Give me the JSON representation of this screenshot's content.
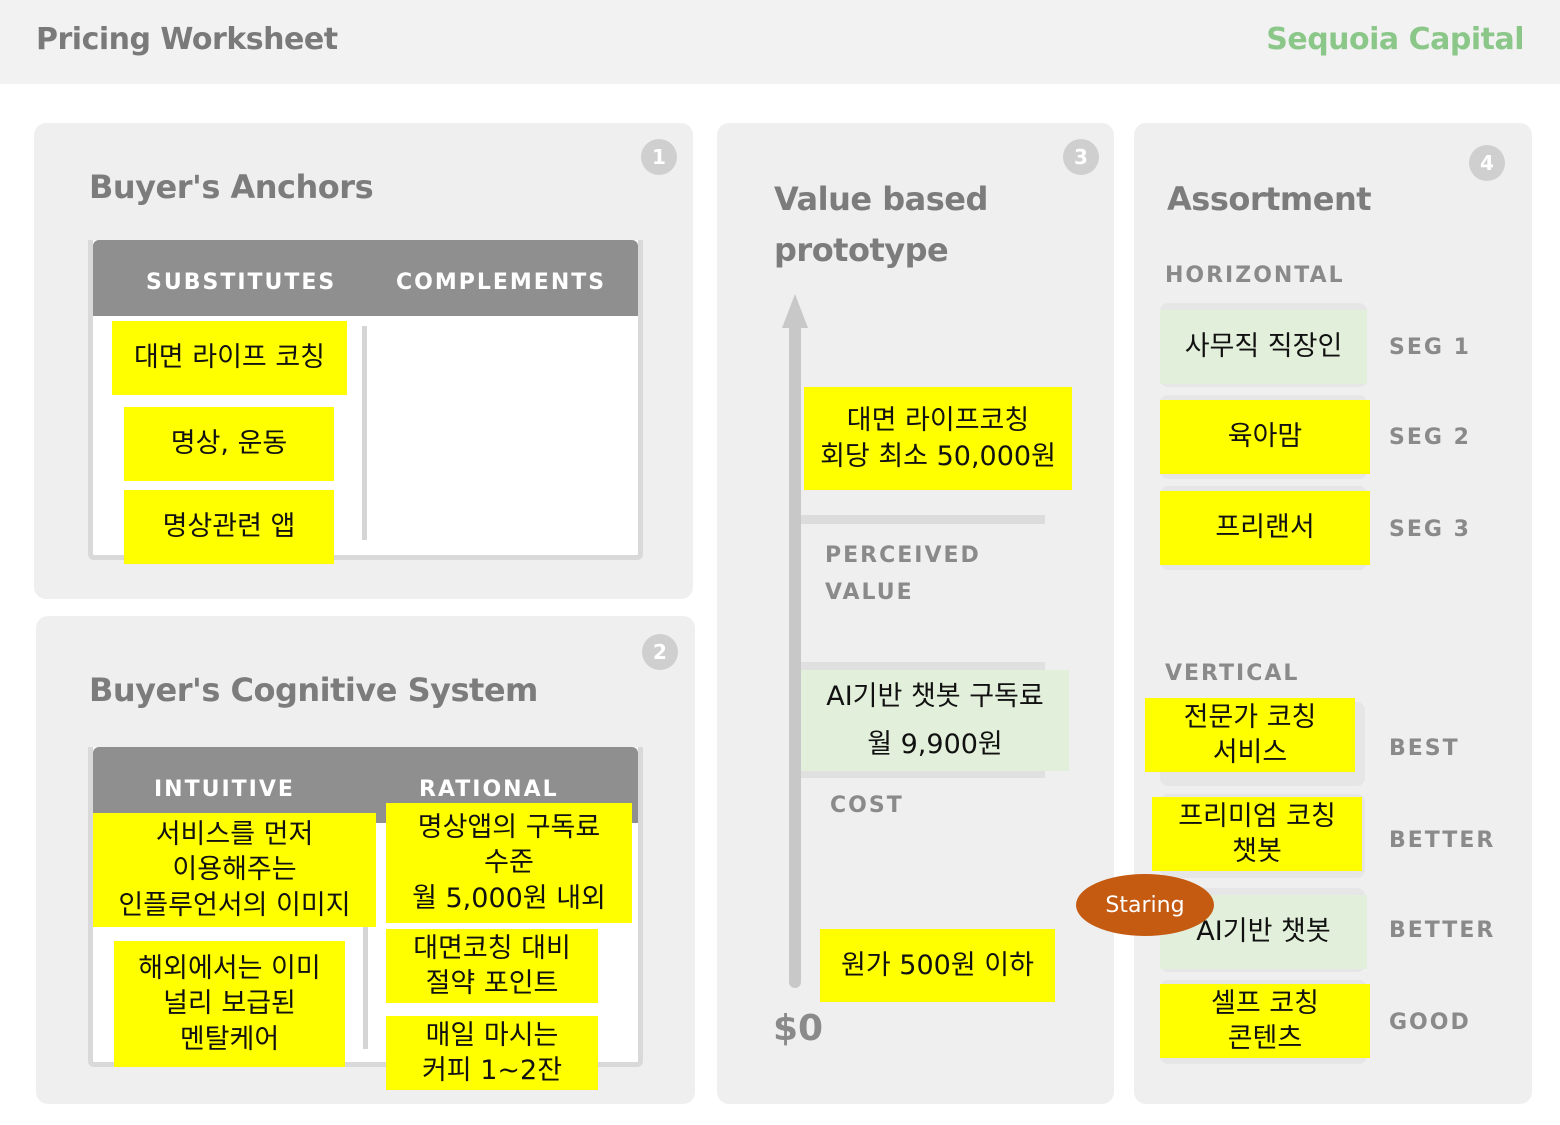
{
  "header": {
    "title": "Pricing Worksheet",
    "brand": "Sequoia Capital"
  },
  "anchors": {
    "num": "1",
    "title": "Buyer's Anchors",
    "col1": "SUBSTITUTES",
    "col2": "COMPLEMENTS",
    "notes": [
      "대면 라이프 코칭",
      "명상, 운동",
      "명상관련 앱"
    ]
  },
  "cognitive": {
    "num": "2",
    "title": "Buyer's Cognitive System",
    "col1": "INTUITIVE",
    "col2": "RATIONAL",
    "intuitive_notes": [
      "서비스를 먼저\n이용해주는\n인플루언서의 이미지",
      "해외에서는 이미\n널리 보급된\n멘탈케어"
    ],
    "rational_notes": [
      "명상앱의 구독료\n수준\n월 5,000원 내외",
      "대면코칭 대비\n절약 포인트",
      "매일 마시는\n커피 1~2잔"
    ]
  },
  "value": {
    "num": "3",
    "title": "Value based\nprototype",
    "perceived_label": "PERCEIVED\nVALUE",
    "cost_label": "COST",
    "zero_label": "$0",
    "perceived_note": "대면 라이프코칭\n회당 최소 50,000원",
    "price_note": "AI기반 챗봇 구독료\n월 9,900원",
    "cost_note": "원가 500원 이하"
  },
  "assortment": {
    "num": "4",
    "title": "Assortment",
    "horizontal_label": "HORIZONTAL",
    "vertical_label": "VERTICAL",
    "horizontal": [
      {
        "text": "사무직 직장인",
        "seg": "SEG 1"
      },
      {
        "text": "육아맘",
        "seg": "SEG 2"
      },
      {
        "text": "프리랜서",
        "seg": "SEG 3"
      }
    ],
    "vertical": [
      {
        "text": "전문가 코칭\n서비스",
        "tier": "BEST"
      },
      {
        "text": "프리미엄 코칭\n챗봇",
        "tier": "BETTER"
      },
      {
        "text": "AI기반 챗봇",
        "tier": "BETTER"
      },
      {
        "text": "셀프 코칭\n콘텐츠",
        "tier": "GOOD"
      }
    ],
    "badge": "Staring"
  },
  "colors": {
    "sticky": "#ffff00",
    "pale_green": "#e2efda",
    "brand": "#8cc78a",
    "badge": "#c55a11"
  }
}
